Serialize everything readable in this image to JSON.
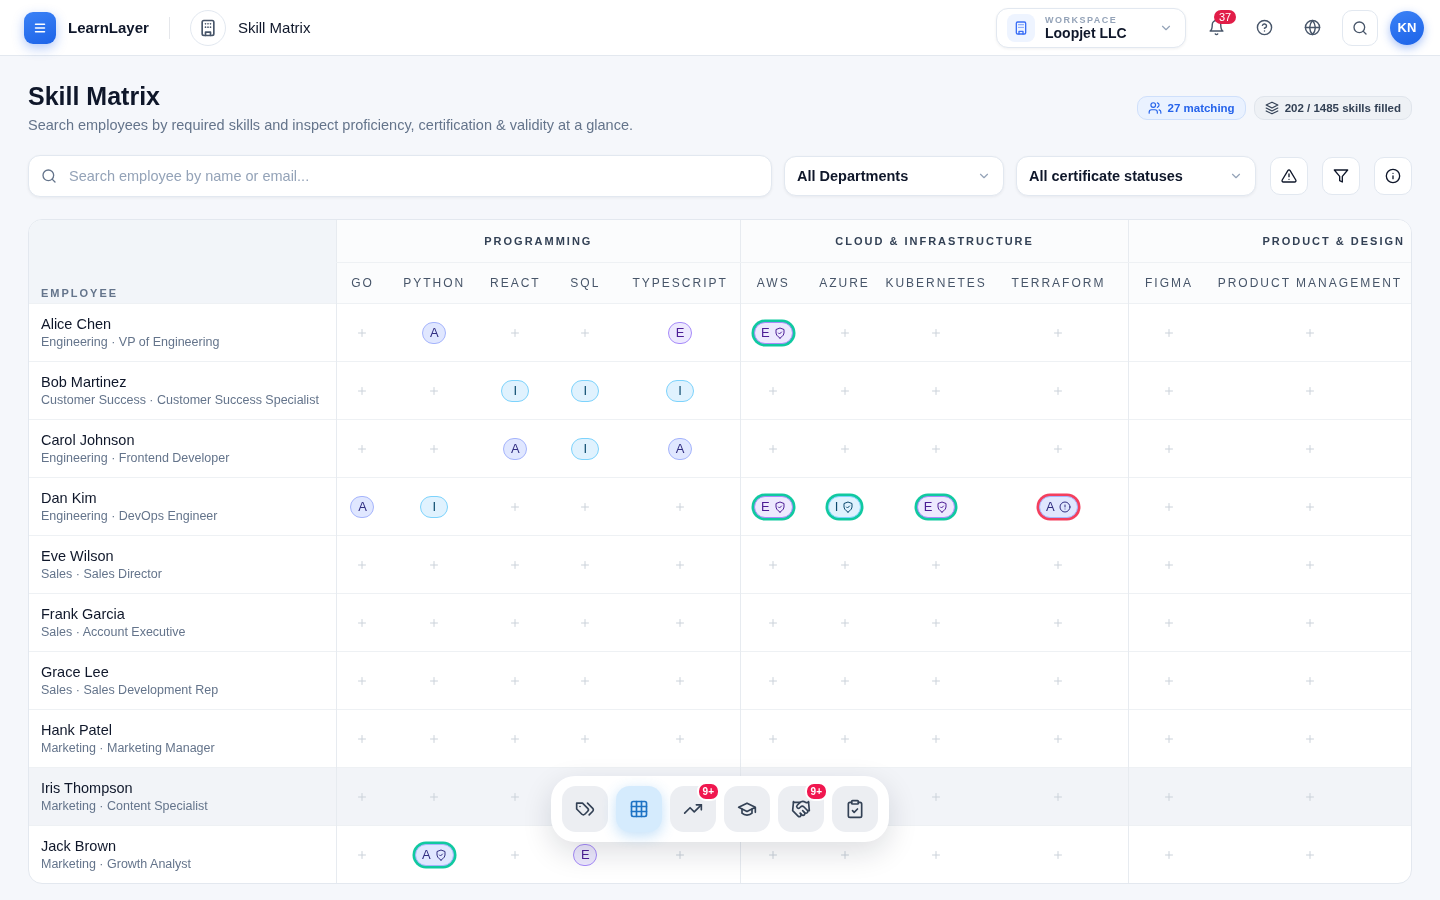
{
  "app": {
    "brand": "LearnLayer",
    "breadcrumb": "Skill Matrix"
  },
  "workspace": {
    "label": "WORKSPACE",
    "name": "Loopjet LLC"
  },
  "notifications": {
    "count": "37"
  },
  "user": {
    "initials": "KN"
  },
  "page": {
    "title": "Skill Matrix",
    "subtitle": "Search employees by required skills and inspect proficiency, certification & validity at a glance.",
    "matching": "27 matching",
    "filled": "202 / 1485 skills filled"
  },
  "filters": {
    "search": {
      "placeholder": "Search employee by name or email..."
    },
    "department": "All Departments",
    "certificate": "All certificate statuses"
  },
  "table": {
    "employee_header": "EMPLOYEE",
    "groups": [
      {
        "name": "PROGRAMMING",
        "skills": [
          "GO",
          "PYTHON",
          "REACT",
          "SQL",
          "TYPESCRIPT"
        ]
      },
      {
        "name": "CLOUD & INFRASTRUCTURE",
        "skills": [
          "AWS",
          "AZURE",
          "KUBERNETES",
          "TERRAFORM"
        ]
      },
      {
        "name": "PRODUCT & DESIGN",
        "skills": [
          "FIGMA",
          "PRODUCT MANAGEMENT"
        ]
      }
    ],
    "rows": [
      {
        "name": "Alice Chen",
        "role": "Engineering · VP of Engineering",
        "selected": false,
        "cells": [
          {
            "kind": "empty"
          },
          {
            "kind": "badge",
            "proficiency": "A",
            "certified": false
          },
          {
            "kind": "empty"
          },
          {
            "kind": "empty"
          },
          {
            "kind": "badge",
            "proficiency": "E",
            "certified": false
          },
          {
            "kind": "badge",
            "proficiency": "E",
            "certified": true,
            "expired": false
          },
          {
            "kind": "empty"
          },
          {
            "kind": "empty"
          },
          {
            "kind": "empty"
          },
          {
            "kind": "empty"
          },
          {
            "kind": "empty"
          }
        ]
      },
      {
        "name": "Bob Martinez",
        "role": "Customer Success · Customer Success Specialist",
        "selected": false,
        "cells": [
          {
            "kind": "empty"
          },
          {
            "kind": "empty"
          },
          {
            "kind": "badge",
            "proficiency": "I",
            "certified": false
          },
          {
            "kind": "badge",
            "proficiency": "I",
            "certified": false
          },
          {
            "kind": "badge",
            "proficiency": "I",
            "certified": false
          },
          {
            "kind": "empty"
          },
          {
            "kind": "empty"
          },
          {
            "kind": "empty"
          },
          {
            "kind": "empty"
          },
          {
            "kind": "empty"
          },
          {
            "kind": "empty"
          }
        ]
      },
      {
        "name": "Carol Johnson",
        "role": "Engineering · Frontend Developer",
        "selected": false,
        "cells": [
          {
            "kind": "empty"
          },
          {
            "kind": "empty"
          },
          {
            "kind": "badge",
            "proficiency": "A",
            "certified": false
          },
          {
            "kind": "badge",
            "proficiency": "I",
            "certified": false
          },
          {
            "kind": "badge",
            "proficiency": "A",
            "certified": false
          },
          {
            "kind": "empty"
          },
          {
            "kind": "empty"
          },
          {
            "kind": "empty"
          },
          {
            "kind": "empty"
          },
          {
            "kind": "empty"
          },
          {
            "kind": "empty"
          }
        ]
      },
      {
        "name": "Dan Kim",
        "role": "Engineering · DevOps Engineer",
        "selected": false,
        "cells": [
          {
            "kind": "badge",
            "proficiency": "A",
            "certified": false
          },
          {
            "kind": "badge",
            "proficiency": "I",
            "certified": false
          },
          {
            "kind": "empty"
          },
          {
            "kind": "empty"
          },
          {
            "kind": "empty"
          },
          {
            "kind": "badge",
            "proficiency": "E",
            "certified": true,
            "expired": false
          },
          {
            "kind": "badge",
            "proficiency": "I",
            "certified": true,
            "expired": false
          },
          {
            "kind": "badge",
            "proficiency": "E",
            "certified": true,
            "expired": false
          },
          {
            "kind": "badge",
            "proficiency": "A",
            "certified": true,
            "expired": true
          },
          {
            "kind": "empty"
          },
          {
            "kind": "empty"
          }
        ]
      },
      {
        "name": "Eve Wilson",
        "role": "Sales · Sales Director",
        "selected": false,
        "cells": [
          {
            "kind": "empty"
          },
          {
            "kind": "empty"
          },
          {
            "kind": "empty"
          },
          {
            "kind": "empty"
          },
          {
            "kind": "empty"
          },
          {
            "kind": "empty"
          },
          {
            "kind": "empty"
          },
          {
            "kind": "empty"
          },
          {
            "kind": "empty"
          },
          {
            "kind": "empty"
          },
          {
            "kind": "empty"
          }
        ]
      },
      {
        "name": "Frank Garcia",
        "role": "Sales · Account Executive",
        "selected": false,
        "cells": [
          {
            "kind": "empty"
          },
          {
            "kind": "empty"
          },
          {
            "kind": "empty"
          },
          {
            "kind": "empty"
          },
          {
            "kind": "empty"
          },
          {
            "kind": "empty"
          },
          {
            "kind": "empty"
          },
          {
            "kind": "empty"
          },
          {
            "kind": "empty"
          },
          {
            "kind": "empty"
          },
          {
            "kind": "empty"
          }
        ]
      },
      {
        "name": "Grace Lee",
        "role": "Sales · Sales Development Rep",
        "selected": false,
        "cells": [
          {
            "kind": "empty"
          },
          {
            "kind": "empty"
          },
          {
            "kind": "empty"
          },
          {
            "kind": "empty"
          },
          {
            "kind": "empty"
          },
          {
            "kind": "empty"
          },
          {
            "kind": "empty"
          },
          {
            "kind": "empty"
          },
          {
            "kind": "empty"
          },
          {
            "kind": "empty"
          },
          {
            "kind": "empty"
          }
        ]
      },
      {
        "name": "Hank Patel",
        "role": "Marketing · Marketing Manager",
        "selected": false,
        "cells": [
          {
            "kind": "empty"
          },
          {
            "kind": "empty"
          },
          {
            "kind": "empty"
          },
          {
            "kind": "empty"
          },
          {
            "kind": "empty"
          },
          {
            "kind": "empty"
          },
          {
            "kind": "empty"
          },
          {
            "kind": "empty"
          },
          {
            "kind": "empty"
          },
          {
            "kind": "empty"
          },
          {
            "kind": "empty"
          }
        ]
      },
      {
        "name": "Iris Thompson",
        "role": "Marketing · Content Specialist",
        "selected": true,
        "cells": [
          {
            "kind": "empty"
          },
          {
            "kind": "empty"
          },
          {
            "kind": "empty"
          },
          {
            "kind": "hidden"
          },
          {
            "kind": "hidden"
          },
          {
            "kind": "hidden"
          },
          {
            "kind": "hidden"
          },
          {
            "kind": "empty"
          },
          {
            "kind": "empty"
          },
          {
            "kind": "empty"
          },
          {
            "kind": "empty"
          }
        ]
      },
      {
        "name": "Jack Brown",
        "role": "Marketing · Growth Analyst",
        "selected": false,
        "cells": [
          {
            "kind": "empty"
          },
          {
            "kind": "badge",
            "proficiency": "A",
            "certified": true,
            "expired": false
          },
          {
            "kind": "empty"
          },
          {
            "kind": "badge",
            "proficiency": "E",
            "certified": false
          },
          {
            "kind": "empty"
          },
          {
            "kind": "empty"
          },
          {
            "kind": "empty"
          },
          {
            "kind": "empty"
          },
          {
            "kind": "empty"
          },
          {
            "kind": "empty"
          },
          {
            "kind": "empty"
          }
        ]
      }
    ]
  },
  "dock": [
    {
      "kind": "tags",
      "selected": false
    },
    {
      "kind": "grid",
      "selected": true
    },
    {
      "kind": "trend",
      "selected": false,
      "badge": "9+"
    },
    {
      "kind": "cap",
      "selected": false
    },
    {
      "kind": "handshake",
      "selected": false,
      "badge": "9+"
    },
    {
      "kind": "clipboard",
      "selected": false
    }
  ]
}
